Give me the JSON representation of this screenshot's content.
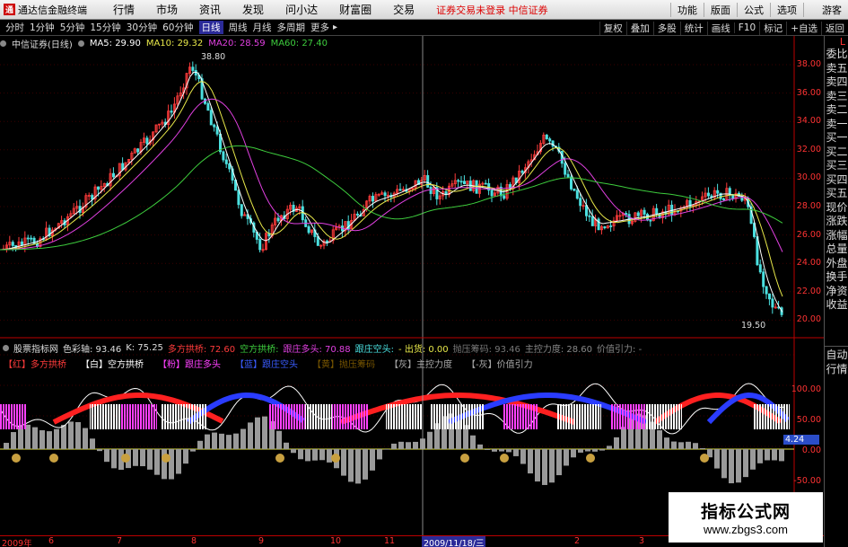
{
  "app": {
    "title": "通达信金融终端",
    "logo_char": "通"
  },
  "menu": [
    "行情",
    "市场",
    "资讯",
    "发现",
    "问小达",
    "财富圈",
    "交易"
  ],
  "status_msg": "证券交易未登录 中信证券",
  "menu_right": [
    "功能",
    "版面",
    "公式",
    "选项",
    "游客"
  ],
  "periods": [
    "分时",
    "1分钟",
    "5分钟",
    "15分钟",
    "30分钟",
    "60分钟",
    "日线",
    "周线",
    "月线",
    "多周期",
    "更多"
  ],
  "selected_period": "日线",
  "toolbar_right": [
    "复权",
    "叠加",
    "多股",
    "统计",
    "画线",
    "F10",
    "标记",
    "+自选",
    "返回"
  ],
  "stock_info": {
    "name": "中信证券(日线)",
    "ma5": "MA5: 29.90",
    "ma10": "MA10: 29.32",
    "ma20": "MA20: 28.59",
    "ma60": "MA60: 27.40"
  },
  "price_axis": [
    "38.00",
    "36.00",
    "34.00",
    "32.00",
    "30.00",
    "28.00",
    "26.00",
    "24.00",
    "22.00",
    "20.00"
  ],
  "peak_label": "38.80",
  "low_label": "19.50",
  "indicator_info": {
    "name": "股票指标网",
    "field1": "色彩轴: 93.46",
    "field2": "K: 75.25",
    "field3": "多方拱桥: 72.60",
    "field4": "空方拱桥:",
    "field5": "跟庄多头: 70.88",
    "field6": "跟庄空头:",
    "field7": "- 出货: 0.00",
    "field8": "抛压筹码: 93.46",
    "field9": "主控力度: 28.60",
    "field10": "价值引力: -"
  },
  "indicator_legend": [
    "【红】多方拱桥",
    "【白】空方拱桥",
    "【粉】跟庄多头",
    "【蓝】跟庄空头",
    "【黄】抛压筹码",
    "【灰】主控力度",
    "【-灰】价值引力"
  ],
  "indicator_axis": [
    "100.00",
    "50.00",
    "0.00",
    "-50.00"
  ],
  "indicator_value_box": "4.24",
  "x_axis": [
    "2009年",
    "6",
    "7",
    "8",
    "9",
    "10",
    "11",
    "2009/11/18/三",
    "2",
    "3"
  ],
  "right_panel": [
    "委比",
    "卖五",
    "卖四",
    "卖三",
    "卖二",
    "卖一",
    "买一",
    "买二",
    "买三",
    "买四",
    "买五",
    "现价",
    "涨跌",
    "涨幅",
    "总量",
    "外盘",
    "换手",
    "净资",
    "收益"
  ],
  "right_panel_top": "L",
  "right_panel_bottom": [
    "自动",
    "行情"
  ],
  "watermark": {
    "title": "指标公式网",
    "url": "www.zbgs3.com"
  },
  "colors": {
    "up": "#ff3b3b",
    "down": "#4be0e0",
    "ma5": "#ffffff",
    "ma10": "#e8e84a",
    "ma20": "#e040e0",
    "ma60": "#3dcc3d",
    "bridge_up": "#ff2020",
    "bridge_down": "#2a3cff",
    "pink": "#ff40ff",
    "gray": "#9a9a9a"
  }
}
